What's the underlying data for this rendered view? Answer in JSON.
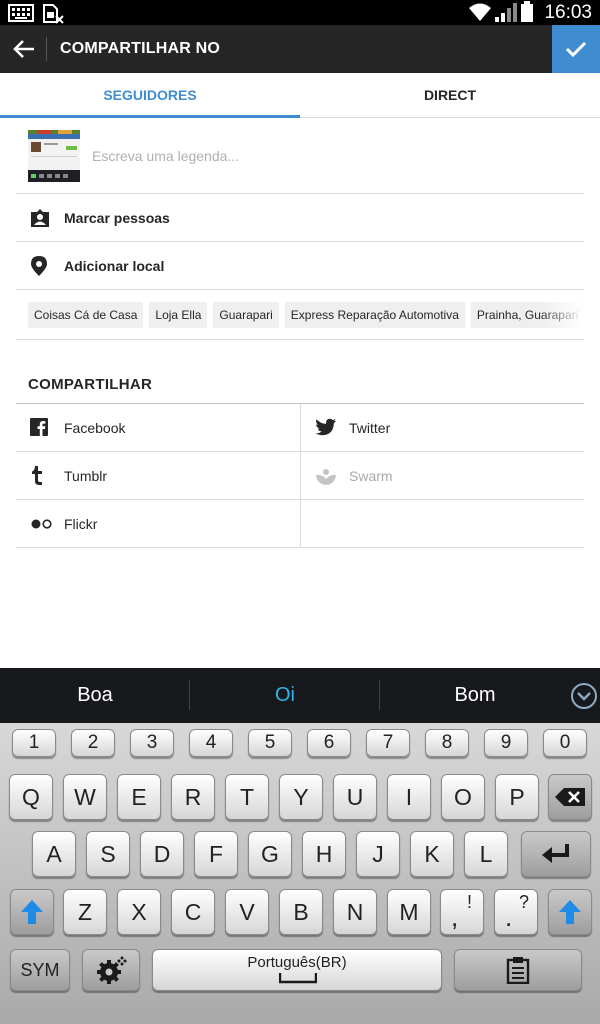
{
  "status": {
    "time": "16:03"
  },
  "header": {
    "title": "COMPARTILHAR NO"
  },
  "tabs": [
    {
      "label": "SEGUIDORES",
      "active": true
    },
    {
      "label": "DIRECT",
      "active": false
    }
  ],
  "caption": {
    "placeholder": "Escreva uma legenda..."
  },
  "options": {
    "tag_people": "Marcar pessoas",
    "add_location": "Adicionar local"
  },
  "location_suggestions": [
    "Coisas Cá de Casa",
    "Loja Ella",
    "Guarapari",
    "Express Reparação Automotiva",
    "Prainha, Guarapari"
  ],
  "share": {
    "title": "COMPARTILHAR",
    "services": [
      {
        "label": "Facebook",
        "icon": "facebook-icon",
        "enabled": true
      },
      {
        "label": "Twitter",
        "icon": "twitter-icon",
        "enabled": true
      },
      {
        "label": "Tumblr",
        "icon": "tumblr-icon",
        "enabled": true
      },
      {
        "label": "Swarm",
        "icon": "swarm-icon",
        "enabled": false
      },
      {
        "label": "Flickr",
        "icon": "flickr-icon",
        "enabled": true
      }
    ]
  },
  "keyboard": {
    "suggestions": [
      "Boa",
      "Oi",
      "Bom"
    ],
    "number_row": [
      "1",
      "2",
      "3",
      "4",
      "5",
      "6",
      "7",
      "8",
      "9",
      "0"
    ],
    "row1": [
      "Q",
      "W",
      "E",
      "R",
      "T",
      "Y",
      "U",
      "I",
      "O",
      "P"
    ],
    "row2": [
      "A",
      "S",
      "D",
      "F",
      "G",
      "H",
      "J",
      "K",
      "L"
    ],
    "row3": [
      "Z",
      "X",
      "C",
      "V",
      "B",
      "N",
      "M"
    ],
    "punct1": ",",
    "punct1_alt": "!",
    "punct2": ".",
    "punct2_alt": "?",
    "sym": "SYM",
    "language": "Português(BR)"
  },
  "colors": {
    "accent": "#3f8dd0",
    "appbar": "#262626",
    "suggestion_highlight": "#33b5e5"
  }
}
